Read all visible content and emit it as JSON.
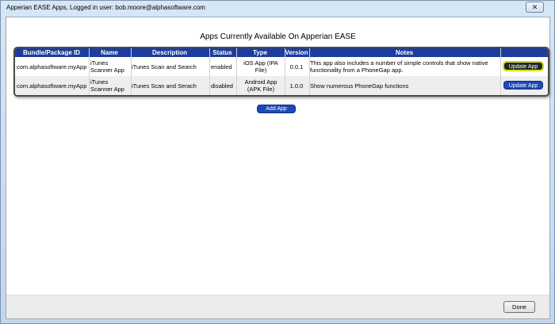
{
  "window": {
    "title": "Apperian EASE Apps, Logged in user: bob.moore@alphasoftware.com",
    "close_glyph": "✕"
  },
  "main": {
    "heading": "Apps Currently Available On Apperian EASE"
  },
  "table": {
    "columns": [
      "Bundle/Package ID",
      "Name",
      "Description",
      "Status",
      "Type",
      "Version",
      "Notes"
    ],
    "rows": [
      {
        "bundle": "com.alphasoftware.myApp",
        "name": "iTunes Scanner App",
        "description": "iTunes Scan and Search",
        "status": "enabled",
        "type": "iOS App (IPA File)",
        "version": "0.0.1",
        "notes": "This app also includes a number of simple controls that show native functionality from a PhoneGap app.",
        "action": "Update App"
      },
      {
        "bundle": "com.alphasoftware.myApp",
        "name": "iTunes Scanner App",
        "description": "iTunes Scan and Serach",
        "status": "disabled",
        "type": "Android App (APK File)",
        "version": "1.0.0",
        "notes": "Show numerous PhoneGap functions",
        "action": "Update App"
      }
    ]
  },
  "add_button": "Add App",
  "footer": {
    "done_label": "Done"
  },
  "colors": {
    "header": "#1c3d9d",
    "button": "#1f48b8",
    "focus_ring": "#e4e818"
  }
}
